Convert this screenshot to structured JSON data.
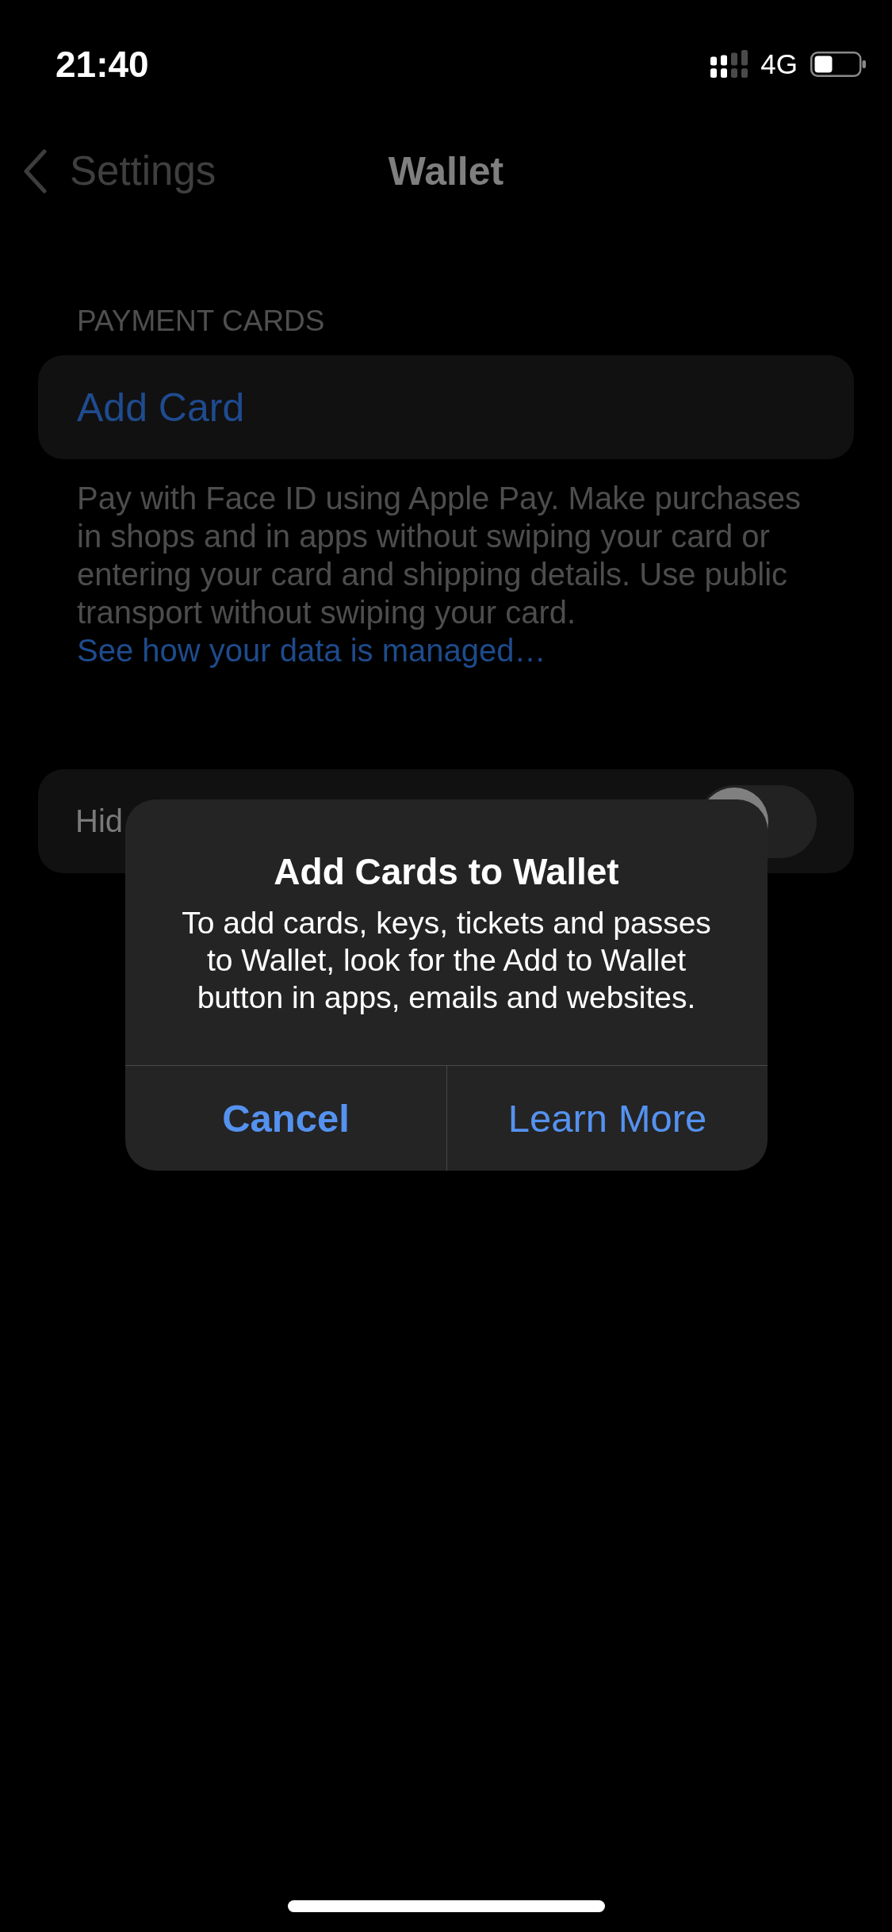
{
  "status_bar": {
    "time": "21:40",
    "network": "4G"
  },
  "nav_bar": {
    "back_label": "Settings",
    "title": "Wallet"
  },
  "sections": [
    {
      "header": "PAYMENT CARDS",
      "rows": [
        {
          "kind": "action",
          "label": "Add Card"
        }
      ],
      "footer": {
        "text": "Pay with Face ID using Apple Pay. Make purchases in shops and in apps without swiping your card or entering your card and shipping details. Use public transport without swiping your card.",
        "link": "See how your data is managed…"
      }
    },
    {
      "rows": [
        {
          "kind": "toggle",
          "label": "Hid",
          "on": false
        }
      ]
    }
  ],
  "alert": {
    "title": "Add Cards to Wallet",
    "message": "To add cards, keys, tickets and passes to Wallet, look for the Add to Wallet button in apps, emails and websites.",
    "buttons": [
      {
        "kind": "cancel",
        "label": "Cancel"
      },
      {
        "kind": "default",
        "label": "Learn More"
      }
    ]
  }
}
